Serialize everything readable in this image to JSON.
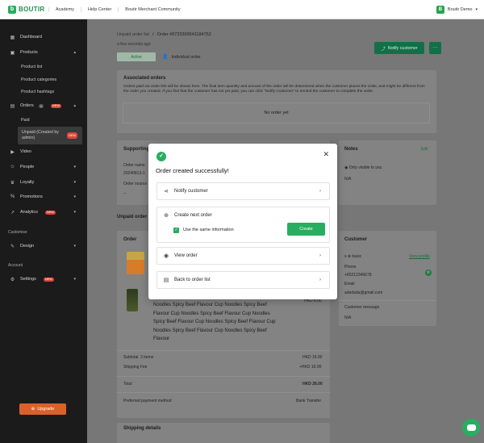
{
  "topbar": {
    "logo": "BOUTIR",
    "nav": [
      "Academy",
      "Help Center",
      "Boutir Merchant Community"
    ],
    "user": "Boutir Demo"
  },
  "sidebar": {
    "dashboard": "Dashboard",
    "products": "Products",
    "product_list": "Product list",
    "product_categories": "Product categories",
    "product_hashtags": "Product hashtags",
    "orders": "Orders",
    "orders_count": "1",
    "new_badge": "NEW",
    "paid": "Paid",
    "unpaid": "Unpaid (Created by admin)",
    "video": "Video",
    "people": "People",
    "loyalty": "Loyalty",
    "promotions": "Promotions",
    "analytics": "Analytics",
    "customise_section": "Customise",
    "design": "Design",
    "account_section": "Account",
    "settings": "Settings",
    "upgrade": "Upgrade"
  },
  "header": {
    "crumb_parent": "Unpaid order list",
    "crumb_sep": "/",
    "crumb_current": "Order #6723399541184752",
    "time": "a few seconds ago",
    "status": "Active",
    "customer_type": "Individual order",
    "notify_btn": "Notify customer",
    "more_btn": "···"
  },
  "associated": {
    "title": "Associated orders",
    "desc": "Orders paid via order link will be shown here. The final item quantity and amount of the order will be determined when the customer places the order, and might be different from the order you created. If you find that the customer has not yet paid, you can click \"Notify Customer\" to remind the customer to complete the order.",
    "empty": "No order yet"
  },
  "supporting": {
    "title": "Supporting",
    "order_name_label": "Order name",
    "order_name_val": "20240813-1",
    "order_source_label": "Order source",
    "order_source_val": "--"
  },
  "notes": {
    "title": "Notes",
    "edit": "Edit",
    "visibility": "Only visible to you",
    "value": "N/A"
  },
  "unpaid_heading": "Unpaid order",
  "order_card": {
    "title": "Order",
    "product_price": "HKD 8.00",
    "product_title": "Noodles Spicy Beef Flavour Cup Noodles Spicy Beef Flavour Cup Noodles Spicy Beef Flavour Cup Noodles Spicy Beef Flavour Cup Noodles Spicy Beef Flavour Cup Noodles Spicy Beef Flavour Cup Noodles Spicy Beef Flavour",
    "subtotal_label": "Subtotal",
    "subtotal_items": "2 items",
    "subtotal_val": "HKD 16.00",
    "shipping_label": "Shipping Fee",
    "shipping_val": "+HKD 10.00",
    "total_label": "Total",
    "total_val": "HKD 26.00",
    "payment_label": "Preferred payment method",
    "payment_val": "Bank Transfer"
  },
  "customer": {
    "title": "Customer",
    "name": "s",
    "tier": "basic",
    "view_profile": "View profile",
    "phone_label": "Phone",
    "phone": "+85212345678",
    "email_label": "Email",
    "email": "adadada@gmail.com",
    "message_label": "Customer message",
    "message": "N/A"
  },
  "shipping_details": {
    "title": "Shipping details"
  },
  "modal": {
    "title": "Order created successfully!",
    "notify": "Notify customer",
    "create_next": "Create next order",
    "same_info": "Use the same information",
    "create_btn": "Create",
    "view_order": "View order",
    "back": "Back to order list"
  },
  "colors": {
    "brand": "#27ae60",
    "dark_green": "#127048",
    "sidebar": "#1b1b1b",
    "new_badge": "#e0443a",
    "upgrade": "#d9622b"
  }
}
